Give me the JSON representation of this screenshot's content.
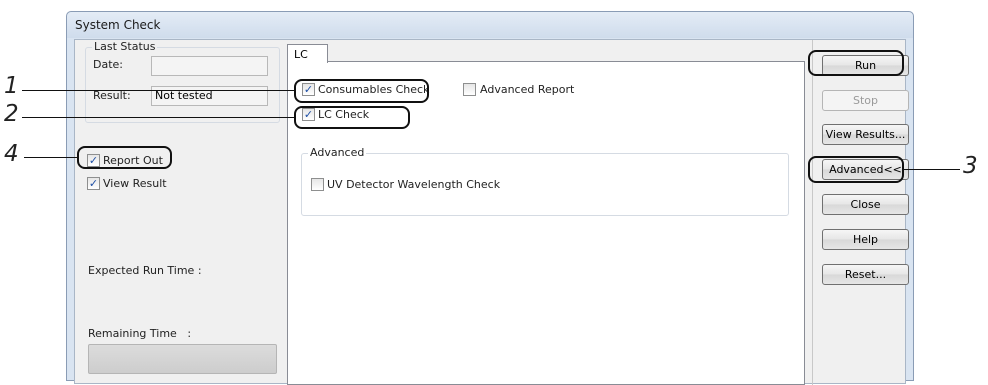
{
  "window": {
    "title": "System Check"
  },
  "last_status": {
    "legend": "Last Status",
    "date_label": "Date:",
    "date_value": "",
    "result_label": "Result:",
    "result_value": "Not tested"
  },
  "left_options": {
    "report_out": {
      "label": "Report Out",
      "checked": true
    },
    "view_result": {
      "label": "View Result",
      "checked": true
    },
    "expected_run_time_label": "Expected Run Time :",
    "remaining_time_label": "Remaining Time   :"
  },
  "tabs": [
    {
      "label": "LC",
      "selected": true
    }
  ],
  "lc_tab": {
    "consumables_check": {
      "label": "Consumables Check",
      "checked": true
    },
    "advanced_report": {
      "label": "Advanced Report",
      "checked": false
    },
    "lc_check": {
      "label": "LC Check",
      "checked": true
    },
    "advanced_group": {
      "legend": "Advanced",
      "uv_detector": {
        "label": "UV Detector Wavelength Check",
        "checked": false
      }
    }
  },
  "buttons": {
    "run": "Run",
    "stop": "Stop",
    "view_results": "View Results...",
    "advanced": "Advanced<<",
    "close": "Close",
    "help": "Help",
    "reset": "Reset..."
  },
  "callouts": [
    "1",
    "2",
    "3",
    "4"
  ],
  "check_mark": "✓"
}
